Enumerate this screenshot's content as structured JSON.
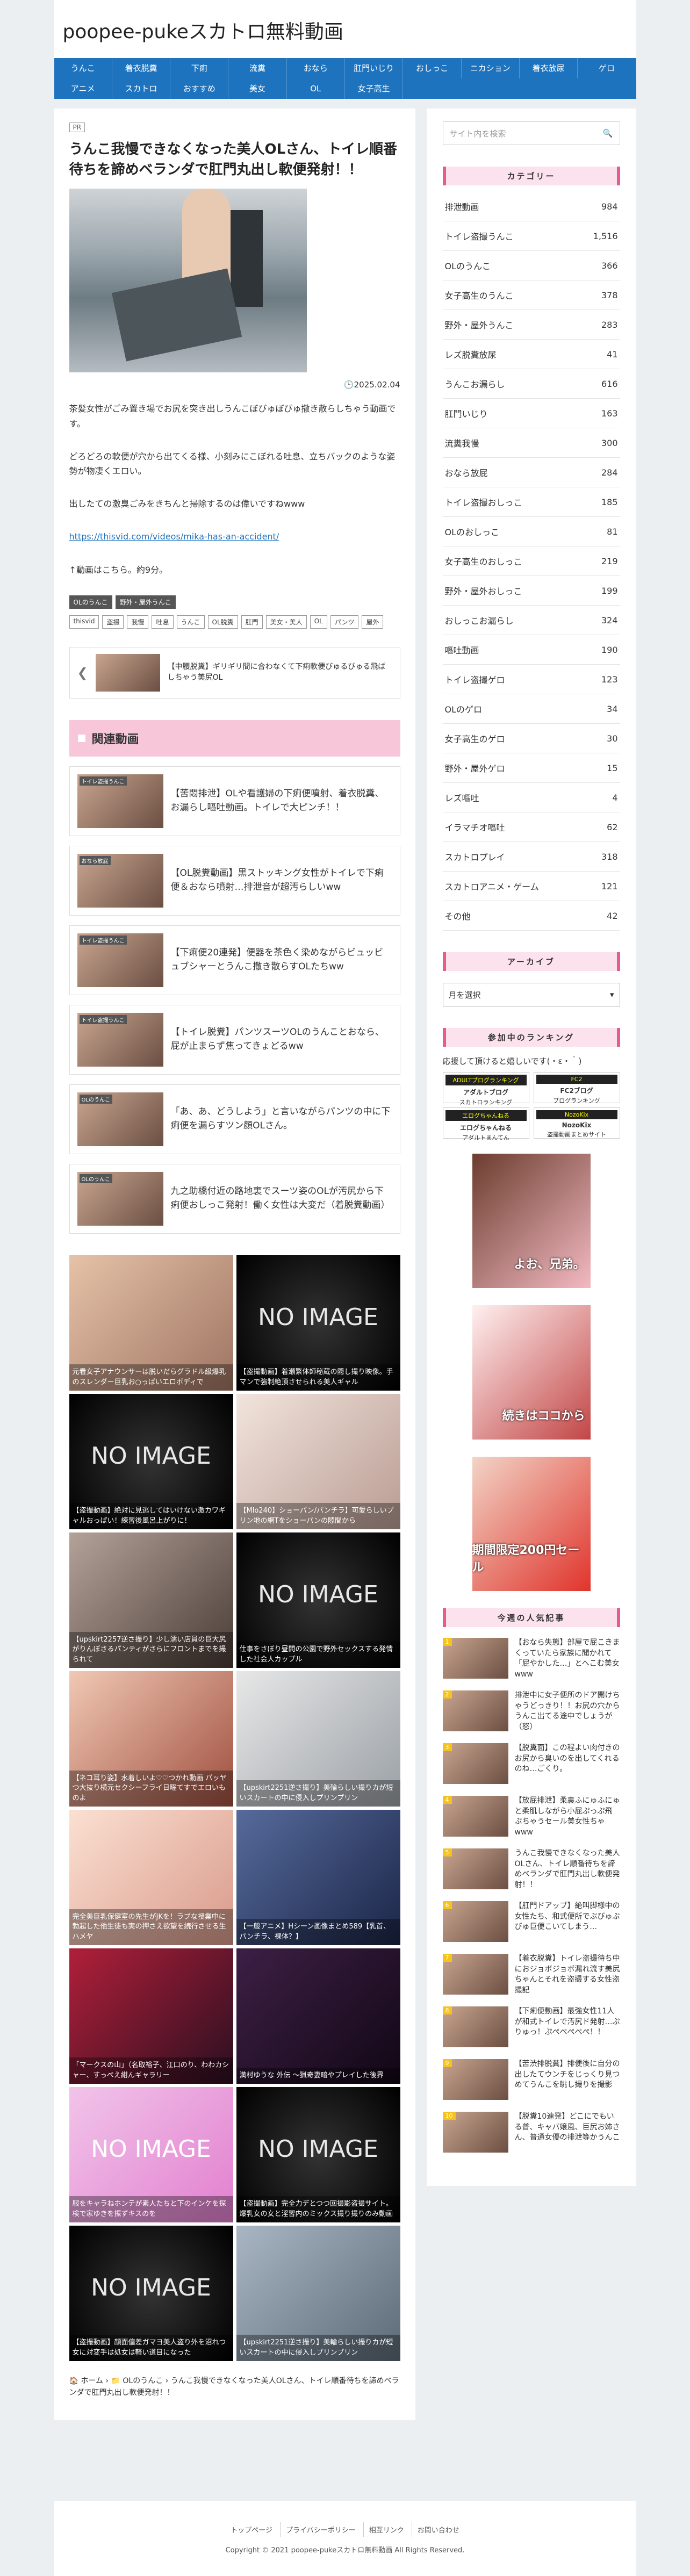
{
  "site": {
    "title": "poopee-pukeスカトロ無料動画"
  },
  "nav": [
    "うんこ",
    "着衣脱糞",
    "下痢",
    "流糞",
    "おなら",
    "肛門いじり",
    "おしっこ",
    "ニカション",
    "着衣放尿",
    "ゲロ",
    "アニメ",
    "スカトロ",
    "おすすめ",
    "美女",
    "OL",
    "女子高生"
  ],
  "post": {
    "pr": "PR",
    "title": "うんこ我慢できなくなった美人OLさん、トイレ順番待ちを諦めベランダで肛門丸出し軟便発射！！",
    "date": "2025.02.04",
    "paragraphs": [
      "茶髪女性がごみ置き場でお尻を突き出しうんこぼびゅぼびゅ撒き散らしちゃう動画です。",
      "どろどろの軟便が穴から出てくる様、小刻みにこぼれる吐息、立ちバックのような姿勢が物凄くエロい。",
      "出したての激臭ごみをきちんと掃除するのは偉いですねwww",
      "https://thisvid.com/videos/mika-has-an-accident/",
      "↑動画はこちら。約9分。"
    ],
    "categories": [
      "OLのうんこ",
      "野外・屋外うんこ"
    ],
    "tags": [
      "thisvid",
      "盗撮",
      "我慢",
      "吐息",
      "うんこ",
      "OL脱糞",
      "肛門",
      "美女・美人",
      "OL",
      "パンツ",
      "屋外"
    ],
    "prev": {
      "arrow": "❮",
      "text": "【中腰脱糞】ギリギリ間に合わなくて下痢軟便びゅるびゅる飛ばしちゃう美尻OL"
    },
    "related_title": "関連動画",
    "related": [
      {
        "badge": "トイレ盗撮うんこ",
        "text": "【苦悶排泄】OLや看護婦の下痢便噴射、着衣脱糞、お漏らし嘔吐動画。トイレで大ピンチ！！"
      },
      {
        "badge": "おなら放屁",
        "text": "【OL脱糞動画】黒ストッキング女性がトイレで下痢便＆おなら噴射…排泄音が超汚らしいww"
      },
      {
        "badge": "トイレ盗撮うんこ",
        "text": "【下痢便20連発】便器を茶色く染めながらビュッビュブシャーとうんこ撒き散らすOLたちww"
      },
      {
        "badge": "トイレ盗撮うんこ",
        "text": "【トイレ脱糞】パンツスーツOLのうんことおなら、屁が止まらず焦ってきょどるww"
      },
      {
        "badge": "OLのうんこ",
        "text": "「あ、あ、どうしよう」と言いながらパンツの中に下痢便を漏らすツン顔OLさん。"
      },
      {
        "badge": "OLのうんこ",
        "text": "九之助橋付近の路地裏でスーツ姿のOLが汚尻から下痢便おしっこ発射！働く女性は大変だ（着脱糞動画）"
      }
    ],
    "grid": [
      {
        "cap": "元看女子アナウンサーは脱いだらグラドル級爆乳のスレンダー巨乳お○っぱいエロボディで",
        "noimg": false,
        "cls": "g1"
      },
      {
        "noimg": true,
        "ni": "NO IMAGE",
        "cap": "【盗撮動画】着瀬繁体師秘蔵の隠し撮り映像。手マンで強制絶頂させられる美人ギャル"
      },
      {
        "noimg": true,
        "ni": "NO IMAGE",
        "cap": "【盗撮動画】絶対に見逃してはいけない激カワギャルおっぱい！練習後風呂上がりに！"
      },
      {
        "noimg": false,
        "cls": "g2",
        "cap": "【Mlo240】ショーパン/パンチラ】可愛らしいプリン地の網Tをショーパンの隙間から"
      },
      {
        "noimg": false,
        "cls": "g3",
        "cap": "【upskirt2257逆さ撮り】少し濡い店員の巨大尻がりんぼさるパンティがさらにフロントまでを撮られて"
      },
      {
        "noimg": true,
        "ni": "NO IMAGE",
        "cap": "仕事をさぼり昼間の公園で野外セックスする発情した社会人カップル"
      },
      {
        "noimg": false,
        "cls": "g4",
        "cap": "【ネコ耳り姿】水着しいよ♡♡つかれ動画 パッヤつ大抜り横元セクシーフライ日曜てすでエロいものよ"
      },
      {
        "noimg": false,
        "cls": "g5",
        "cap": "【upskirt2251逆さ撮り】美輪らしい撮りカが短いスカートの中に侵入しプリンプリン"
      },
      {
        "noimg": false,
        "cls": "g6",
        "cap": "完全美巨乳保健室の先生がJKを！ラブな授業中に勃起した他生徒も実の押さえ欲望を続行させる生ハメヤ"
      },
      {
        "noimg": false,
        "cls": "g7",
        "cap": "【一般アニメ】Hシーン画像まとめ589【乳首、パンチラ、裸体？】"
      },
      {
        "noimg": false,
        "cls": "g8",
        "cap": "「マークスの山」（名取裕子、江口のり、わわカシャー、すっぺえ紺んギャラリー"
      },
      {
        "noimg": false,
        "cls": "g9",
        "cap": "満村ゆうな 外伝 〜猟奇妻暗やプレイした後界"
      },
      {
        "noimg": true,
        "ni": "NO IMAGE",
        "cls": "g10noimg",
        "cap": "服をキャラねホンテが素人たちと下のインケを探検で家ゆきを振ずキスのを"
      },
      {
        "noimg": true,
        "ni": "NO IMAGE",
        "cap": "【盗撮動画】完全力デとつつ回撮影盗撮サイト。爆乳女の女と淫習内のミックス撮り撮りのみ動画"
      },
      {
        "noimg": true,
        "ni": "NO IMAGE",
        "cap": "【盗撮動画】顔面偏差ガマヨ美人盗り外を沼れつ女に対変手は処女は軽い道目になった"
      },
      {
        "noimg": false,
        "cls": "g10",
        "cap": "【upskirt2251逆さ撮り】美輪らしい撮りカが短いスカートの中に侵入しプリンプリン"
      }
    ],
    "breadcrumb": {
      "home": "ホーム",
      "sep": "›",
      "cat": "OLのうんこ",
      "current": "うんこ我慢できなくなった美人OLさん、トイレ順番待ちを諦めベランダで肛門丸出し軟便発射！！"
    }
  },
  "sidebar": {
    "search_placeholder": "サイト内を検索",
    "categories_title": "カテゴリー",
    "categories": [
      {
        "name": "排泄動画",
        "count": "984"
      },
      {
        "name": "トイレ盗撮うんこ",
        "count": "1,516"
      },
      {
        "name": "OLのうんこ",
        "count": "366"
      },
      {
        "name": "女子高生のうんこ",
        "count": "378"
      },
      {
        "name": "野外・屋外うんこ",
        "count": "283"
      },
      {
        "name": "レズ脱糞放尿",
        "count": "41"
      },
      {
        "name": "うんこお漏らし",
        "count": "616"
      },
      {
        "name": "肛門いじり",
        "count": "163"
      },
      {
        "name": "流糞我慢",
        "count": "300"
      },
      {
        "name": "おなら放屁",
        "count": "284"
      },
      {
        "name": "トイレ盗撮おしっこ",
        "count": "185"
      },
      {
        "name": "OLのおしっこ",
        "count": "81"
      },
      {
        "name": "女子高生のおしっこ",
        "count": "219"
      },
      {
        "name": "野外・屋外おしっこ",
        "count": "199"
      },
      {
        "name": "おしっこお漏らし",
        "count": "324"
      },
      {
        "name": "嘔吐動画",
        "count": "190"
      },
      {
        "name": "トイレ盗撮ゲロ",
        "count": "123"
      },
      {
        "name": "OLのゲロ",
        "count": "34"
      },
      {
        "name": "女子高生のゲロ",
        "count": "30"
      },
      {
        "name": "野外・屋外ゲロ",
        "count": "15"
      },
      {
        "name": "レズ嘔吐",
        "count": "4"
      },
      {
        "name": "イラマチオ嘔吐",
        "count": "62"
      },
      {
        "name": "スカトロプレイ",
        "count": "318"
      },
      {
        "name": "スカトロアニメ・ゲーム",
        "count": "121"
      },
      {
        "name": "その他",
        "count": "42"
      }
    ],
    "archive_title": "アーカイブ",
    "archive_select": "月を選択",
    "ranking_title": "参加中のランキング",
    "ranking_text": "応援して頂けると嬉しいです(・ε・｀)",
    "ranking_banners": [
      {
        "logo": "ADULTブログランキング",
        "name": "アダルトブログ",
        "sub": "スカトロランキング"
      },
      {
        "logo": "FC2",
        "name": "FC2ブログ",
        "sub": "ブログランキング"
      },
      {
        "logo": "エログちゃんねる",
        "name": "エログちゃんねる",
        "sub": "アダルトまんてん"
      },
      {
        "logo": "NozoKix",
        "name": "NozoKix",
        "sub": "盗撮動画まとめサイト"
      }
    ],
    "ads": [
      {
        "text": "よお、兄弟。"
      },
      {
        "text": "続きはココから"
      },
      {
        "text": "期間限定200円セール"
      }
    ],
    "popular_title": "今週の人気記事",
    "popular": [
      {
        "n": "1",
        "text": "【おなら失態】部屋で屁こきまくっていたら家族に聞かれて「屁やかした…」とへこむ美女www"
      },
      {
        "n": "2",
        "text": "排泄中に女子便所のドア開けちゃうどっきり！！お尻の穴からうんこ出てる途中でしょうが（怒）"
      },
      {
        "n": "3",
        "text": "【脱糞面】この程よい肉付きのお尻から臭いのを出してくれるのね…ごくり。"
      },
      {
        "n": "4",
        "text": "【放屁排泄】柔裏ふにゅふにゅと柔肌しながら小屁ぷっぷ飛ぶちゃうセール美女性ちゃwww"
      },
      {
        "n": "5",
        "text": "うんこ我慢できなくなった美人OLさん、トイレ順番待ちを諦めベランダで肛門丸出し軟便発射！！"
      },
      {
        "n": "6",
        "text": "【肛門ドアップ】絶叫脚様中の女性たち、和式便所でぶびゅぶびゅ巨便こいてしまう…"
      },
      {
        "n": "7",
        "text": "【着衣脱糞】トイレ盗撮待ち中におジョボジョボ漏れ流す美尻ちゃんとそれを盗撮する女性盗撮記"
      },
      {
        "n": "8",
        "text": "【下痢便動画】最強女性11人が和式トイレで汚尻ド発射…ぷりゅっ！ぷぺぺぺぺぺ！！"
      },
      {
        "n": "9",
        "text": "【苦渋排脱糞】排便後に自分の出したてウンチをじっくり見つめてうんこを眺し撮りを撮影"
      },
      {
        "n": "10",
        "text": "【脱糞10連発】どこにでもいる普、キャバ嬢風、巨尻お姉さん、普通女優の排泄等かうんこ"
      }
    ]
  },
  "footer": {
    "links": [
      "トップページ",
      "プライバシーポリシー",
      "相互リンク",
      "お問い合わせ"
    ],
    "copyright": "Copyright © 2021 poopee-pukeスカトロ無料動画 All Rights Reserved."
  }
}
